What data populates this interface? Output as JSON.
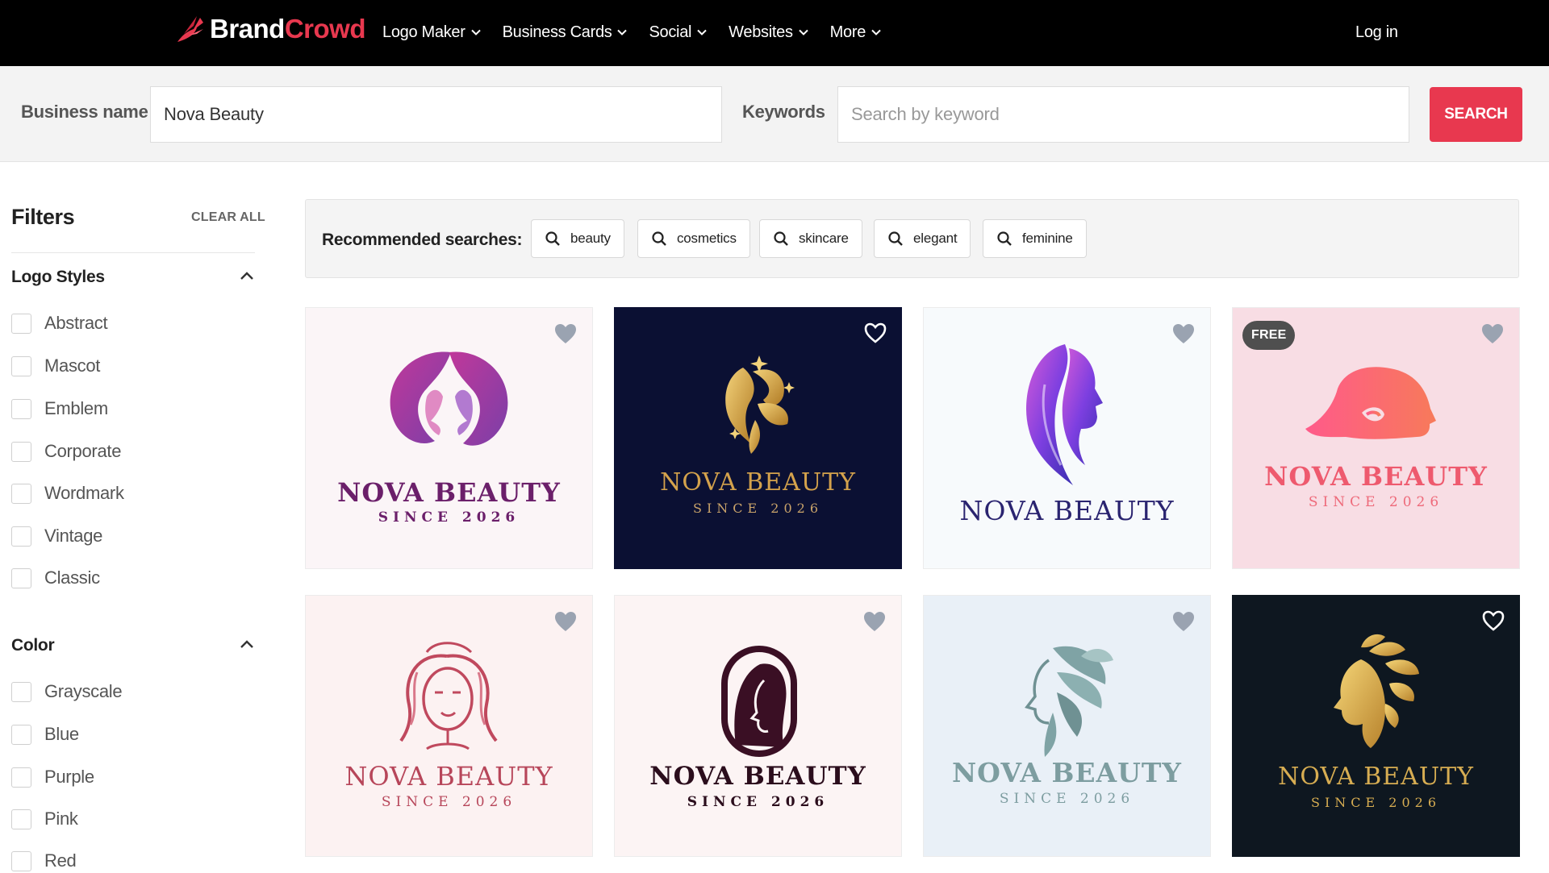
{
  "brand": {
    "part1": "Brand",
    "part2": "Crowd"
  },
  "nav": {
    "items": [
      {
        "label": "Logo Maker"
      },
      {
        "label": "Business Cards"
      },
      {
        "label": "Social"
      },
      {
        "label": "Websites"
      },
      {
        "label": "More"
      }
    ],
    "login": "Log in"
  },
  "search": {
    "business_label": "Business name",
    "business_value": "Nova Beauty",
    "keywords_label": "Keywords",
    "keywords_placeholder": "Search by keyword",
    "button": "SEARCH"
  },
  "filters": {
    "title": "Filters",
    "clear_all": "CLEAR ALL",
    "logo_styles": {
      "title": "Logo Styles",
      "options": [
        "Abstract",
        "Mascot",
        "Emblem",
        "Corporate",
        "Wordmark",
        "Vintage",
        "Classic"
      ]
    },
    "color": {
      "title": "Color",
      "options": [
        "Grayscale",
        "Blue",
        "Purple",
        "Pink",
        "Red"
      ]
    }
  },
  "recommended": {
    "label": "Recommended searches:",
    "chips": [
      "beauty",
      "cosmetics",
      "skincare",
      "elegant",
      "feminine"
    ]
  },
  "logos": [
    {
      "name": "NOVA BEAUTY",
      "tagline": "SINCE 2026",
      "bg": "#fbf5f7",
      "text_color": "#6b1f6a",
      "sub_color": "#6b1f6a",
      "icon": "two-women-profile-icon",
      "free": false
    },
    {
      "name": "NOVA BEAUTY",
      "tagline": "SINCE 2026",
      "bg": "#0b1033",
      "text_color": "#d4a24c",
      "sub_color": "#c9a36a",
      "icon": "gold-leaf-woman-icon",
      "free": false
    },
    {
      "name": "NOVA BEAUTY",
      "tagline": "",
      "bg": "#f7fafc",
      "text_color": "#2a2470",
      "sub_color": "#2a2470",
      "icon": "purple-hair-woman-icon",
      "free": false
    },
    {
      "name": "NOVA BEAUTY",
      "tagline": "SINCE 2026",
      "bg": "#f8dde4",
      "text_color": "#ee5a6e",
      "sub_color": "#ee6a7a",
      "icon": "pink-hair-woman-icon",
      "free": true,
      "free_label": "FREE"
    },
    {
      "name": "NOVA BEAUTY",
      "tagline": "SINCE 2026",
      "bg": "#fcf2f2",
      "text_color": "#b7465a",
      "sub_color": "#b7465a",
      "icon": "line-art-woman-icon",
      "free": false
    },
    {
      "name": "NOVA BEAUTY",
      "tagline": "SINCE 2026",
      "bg": "#fcf4f4",
      "text_color": "#2b0d1c",
      "sub_color": "#2b0d1c",
      "icon": "oval-portrait-woman-icon",
      "free": false
    },
    {
      "name": "NOVA BEAUTY",
      "tagline": "SINCE 2026",
      "bg": "#e9f0f7",
      "text_color": "#7d9da0",
      "sub_color": "#7d9da0",
      "icon": "teal-leaf-woman-icon",
      "free": false
    },
    {
      "name": "NOVA BEAUTY",
      "tagline": "SINCE 2026",
      "bg": "#0e1720",
      "text_color": "#d7ad52",
      "sub_color": "#d7ad52",
      "icon": "gold-laurel-woman-icon",
      "free": false
    }
  ],
  "colors": {
    "accent": "#e8384f",
    "nav_bg": "#000000"
  }
}
